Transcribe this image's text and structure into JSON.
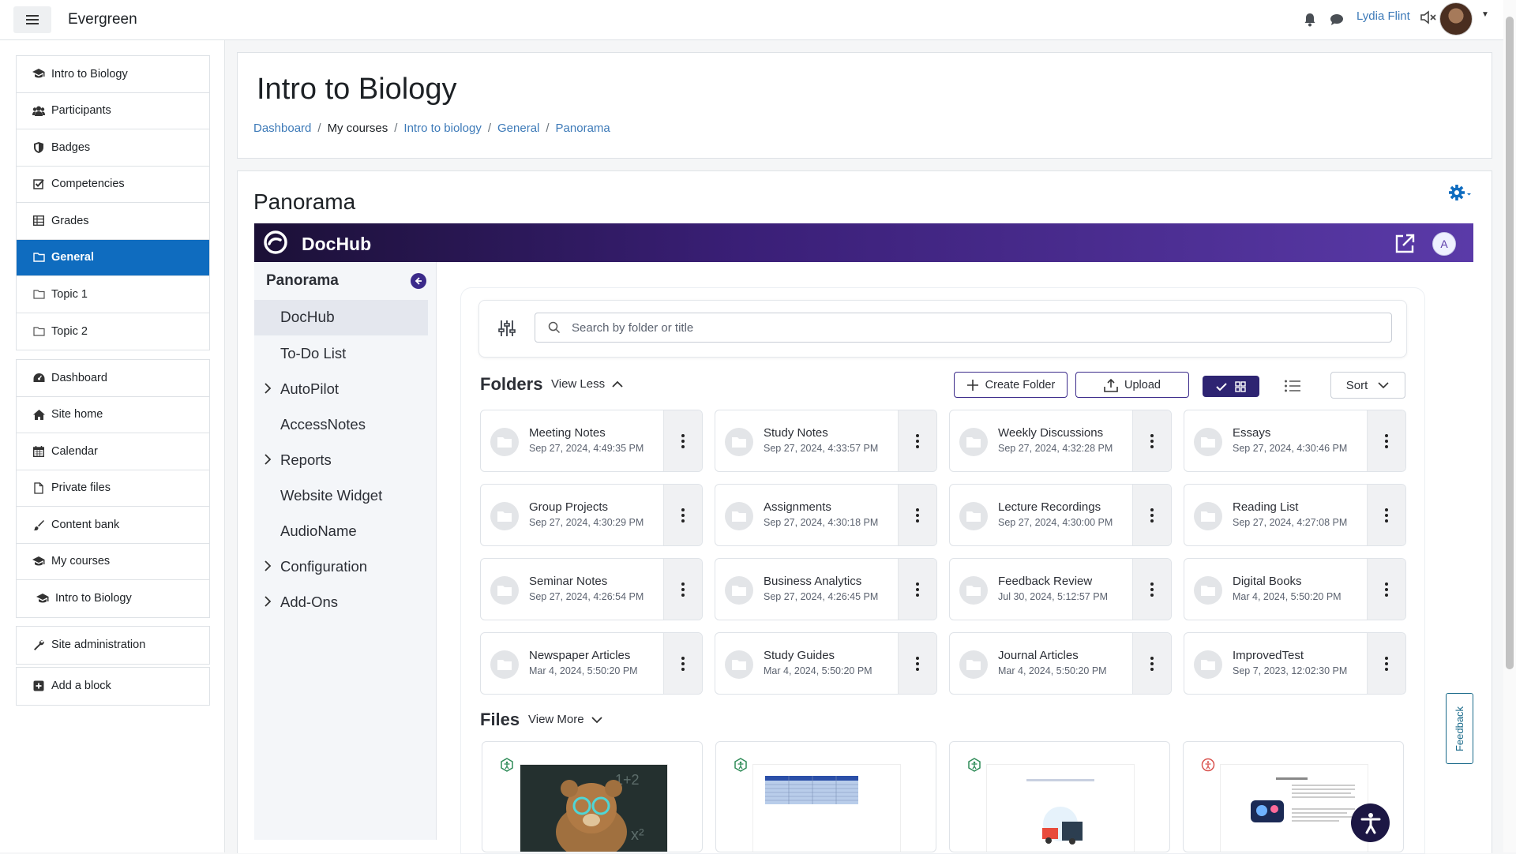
{
  "app": {
    "brand": "Evergreen",
    "user": "Lydia Flint"
  },
  "drawer": {
    "group1": [
      {
        "label": "Intro to Biology",
        "icon": "graduation-cap-icon"
      },
      {
        "label": "Participants",
        "icon": "users-icon"
      },
      {
        "label": "Badges",
        "icon": "shield-icon"
      },
      {
        "label": "Competencies",
        "icon": "checkbox-icon"
      },
      {
        "label": "Grades",
        "icon": "table-icon"
      },
      {
        "label": "General",
        "icon": "folder-icon",
        "active": true
      },
      {
        "label": "Topic 1",
        "icon": "folder-icon"
      },
      {
        "label": "Topic 2",
        "icon": "folder-icon"
      }
    ],
    "group2": [
      {
        "label": "Dashboard",
        "icon": "dashboard-icon"
      },
      {
        "label": "Site home",
        "icon": "home-icon"
      },
      {
        "label": "Calendar",
        "icon": "calendar-icon"
      },
      {
        "label": "Private files",
        "icon": "file-icon"
      },
      {
        "label": "Content bank",
        "icon": "brush-icon"
      },
      {
        "label": "My courses",
        "icon": "graduation-cap-icon"
      },
      {
        "label": "Intro to Biology",
        "icon": "graduation-cap-icon",
        "indent": true
      }
    ],
    "group3": [
      {
        "label": "Site administration",
        "icon": "wrench-icon"
      }
    ],
    "group4": [
      {
        "label": "Add a block",
        "icon": "plus-square-icon"
      }
    ]
  },
  "page": {
    "title": "Intro to Biology",
    "breadcrumb": [
      {
        "label": "Dashboard",
        "link": true
      },
      {
        "label": "My courses",
        "link": false
      },
      {
        "label": "Intro to biology",
        "link": true
      },
      {
        "label": "General",
        "link": true
      },
      {
        "label": "Panorama",
        "link": true
      }
    ],
    "section_title": "Panorama"
  },
  "dochub": {
    "logo_text": "DocHub",
    "avatar_letter": "A",
    "side_title": "Panorama",
    "menu": [
      {
        "label": "DocHub",
        "selected": true,
        "expandable": false
      },
      {
        "label": "To-Do List",
        "selected": false,
        "expandable": false
      },
      {
        "label": "AutoPilot",
        "selected": false,
        "expandable": true
      },
      {
        "label": "AccessNotes",
        "selected": false,
        "expandable": false
      },
      {
        "label": "Reports",
        "selected": false,
        "expandable": true
      },
      {
        "label": "Website Widget",
        "selected": false,
        "expandable": false
      },
      {
        "label": "AudioName",
        "selected": false,
        "expandable": false
      },
      {
        "label": "Configuration",
        "selected": false,
        "expandable": true
      },
      {
        "label": "Add-Ons",
        "selected": false,
        "expandable": true
      }
    ],
    "search_placeholder": "Search by folder or title",
    "folders_heading": "Folders",
    "view_less": "View Less",
    "create_folder": "Create Folder",
    "upload": "Upload",
    "sort": "Sort",
    "folders": [
      {
        "name": "Meeting Notes",
        "date": "Sep 27, 2024, 4:49:35 PM"
      },
      {
        "name": "Study Notes",
        "date": "Sep 27, 2024, 4:33:57 PM"
      },
      {
        "name": "Weekly Discussions",
        "date": "Sep 27, 2024, 4:32:28 PM"
      },
      {
        "name": "Essays",
        "date": "Sep 27, 2024, 4:30:46 PM"
      },
      {
        "name": "Group Projects",
        "date": "Sep 27, 2024, 4:30:29 PM"
      },
      {
        "name": "Assignments",
        "date": "Sep 27, 2024, 4:30:18 PM"
      },
      {
        "name": "Lecture Recordings",
        "date": "Sep 27, 2024, 4:30:00 PM"
      },
      {
        "name": "Reading List",
        "date": "Sep 27, 2024, 4:27:08 PM"
      },
      {
        "name": "Seminar Notes",
        "date": "Sep 27, 2024, 4:26:54 PM"
      },
      {
        "name": "Business Analytics",
        "date": "Sep 27, 2024, 4:26:45 PM"
      },
      {
        "name": "Feedback Review",
        "date": "Jul 30, 2024, 5:12:57 PM"
      },
      {
        "name": "Digital Books",
        "date": "Mar 4, 2024, 5:50:20 PM"
      },
      {
        "name": "Newspaper Articles",
        "date": "Mar 4, 2024, 5:50:20 PM"
      },
      {
        "name": "Study Guides",
        "date": "Mar 4, 2024, 5:50:20 PM"
      },
      {
        "name": "Journal Articles",
        "date": "Mar 4, 2024, 5:50:20 PM"
      },
      {
        "name": "ImprovedTest",
        "date": "Sep 7, 2023, 12:02:30 PM"
      }
    ],
    "files_heading": "Files",
    "view_more": "View More",
    "files": [
      {
        "thumb": "teddy-bear-image",
        "badge_color": "#2e8b57"
      },
      {
        "thumb": "spreadsheet-image",
        "badge_color": "#2e8b57"
      },
      {
        "thumb": "transportation-doc-image",
        "badge_color": "#2e8b57"
      },
      {
        "thumb": "exploring-space-doc-image",
        "badge_color": "#d9534f"
      }
    ],
    "feedback": "Feedback"
  },
  "colors": {
    "primary": "#0f6cbf",
    "link": "#3d7ab8",
    "dochub_dark": "#2e2472"
  }
}
